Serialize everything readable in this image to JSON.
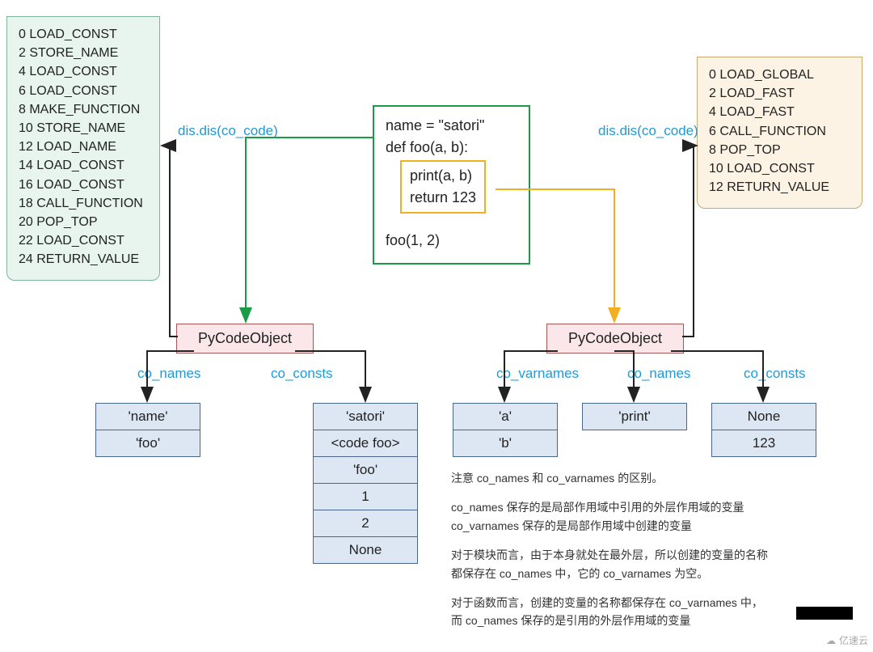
{
  "dis_left": [
    "0 LOAD_CONST",
    "2 STORE_NAME",
    "4 LOAD_CONST",
    "6 LOAD_CONST",
    "8 MAKE_FUNCTION",
    "10 STORE_NAME",
    "12 LOAD_NAME",
    "14 LOAD_CONST",
    "16 LOAD_CONST",
    "18 CALL_FUNCTION",
    "20 POP_TOP",
    "22 LOAD_CONST",
    "24 RETURN_VALUE"
  ],
  "dis_right": [
    "0 LOAD_GLOBAL",
    "2 LOAD_FAST",
    "4 LOAD_FAST",
    "6 CALL_FUNCTION",
    "8 POP_TOP",
    "10 LOAD_CONST",
    "12 RETURN_VALUE"
  ],
  "source": {
    "line1": "name = \"satori\"",
    "line2": "def foo(a, b):",
    "body1": "print(a, b)",
    "body2": "return 123",
    "line5": "foo(1, 2)"
  },
  "labels": {
    "dis_left": "dis.dis(co_code)",
    "dis_right": "dis.dis(co_code)",
    "pycode": "PyCodeObject",
    "co_names": "co_names",
    "co_consts": "co_consts",
    "co_varnames": "co_varnames"
  },
  "left": {
    "names": [
      "'name'",
      "'foo'"
    ],
    "consts": [
      "'satori'",
      "<code foo>",
      "'foo'",
      "1",
      "2",
      "None"
    ]
  },
  "right": {
    "varnames": [
      "'a'",
      "'b'"
    ],
    "names": [
      "'print'"
    ],
    "consts": [
      "None",
      "123"
    ]
  },
  "notes": {
    "p1": "注意 co_names 和 co_varnames 的区别。",
    "p2a": "co_names 保存的是局部作用域中引用的外层作用域的变量",
    "p2b": "co_varnames 保存的是局部作用域中创建的变量",
    "p3a": "对于模块而言，由于本身就处在最外层，所以创建的变量的名称",
    "p3b": "都保存在 co_names 中，它的 co_varnames 为空。",
    "p4a": "对于函数而言，创建的变量的名称都保存在 co_varnames 中，",
    "p4b": "而 co_names 保存的是引用的外层作用域的变量"
  },
  "watermark": "亿速云"
}
